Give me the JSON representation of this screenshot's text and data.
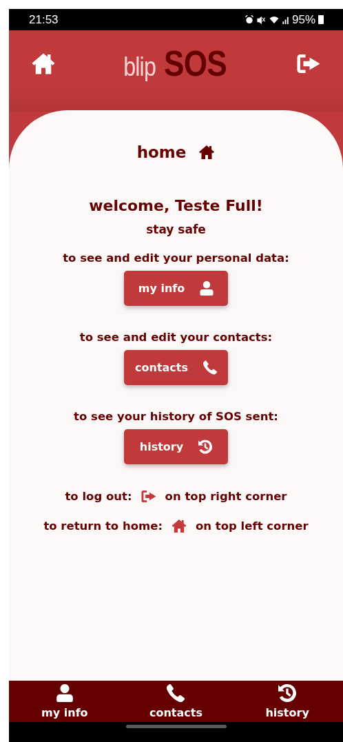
{
  "status_bar": {
    "time": "21:53",
    "battery": "95%"
  },
  "header": {
    "logo_light": "blip",
    "logo_bold": "SOS"
  },
  "page_title": "home",
  "welcome": "welcome, Teste Full!",
  "subtitle": "stay safe",
  "sections": [
    {
      "prompt": "to see and edit your personal data:",
      "button": {
        "label": "my info",
        "kind": "user"
      }
    },
    {
      "prompt": "to see and edit your contacts:",
      "button": {
        "label": "contacts",
        "kind": "phone"
      }
    },
    {
      "prompt": "to see your history of SOS sent:",
      "button": {
        "label": "history",
        "kind": "history"
      }
    }
  ],
  "hints": [
    {
      "before": "to log out:",
      "kind": "logout",
      "after": "on top right corner"
    },
    {
      "before": "to return to home:",
      "kind": "home",
      "after": "on top left corner"
    }
  ],
  "bottom_nav": [
    {
      "label": "my info",
      "kind": "user"
    },
    {
      "label": "contacts",
      "kind": "phone"
    },
    {
      "label": "history",
      "kind": "history"
    }
  ]
}
